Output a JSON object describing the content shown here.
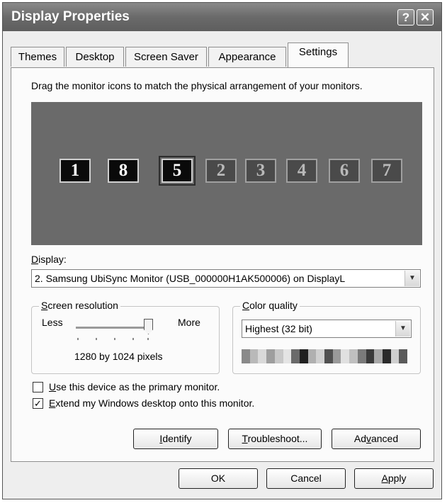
{
  "window": {
    "title": "Display Properties",
    "help_label": "?",
    "close_label": "✕"
  },
  "tabs": [
    {
      "label": "Themes"
    },
    {
      "label": "Desktop"
    },
    {
      "label": "Screen Saver"
    },
    {
      "label": "Appearance"
    },
    {
      "label": "Settings",
      "active": true
    }
  ],
  "settings": {
    "instruction": "Drag the monitor icons to match the physical arrangement of your monitors.",
    "monitors": [
      {
        "number": "1",
        "state": "active"
      },
      {
        "number": "8",
        "state": "active"
      },
      {
        "number": "5",
        "state": "active-selected"
      },
      {
        "number": "2",
        "state": "inactive"
      },
      {
        "number": "3",
        "state": "inactive"
      },
      {
        "number": "4",
        "state": "inactive"
      },
      {
        "number": "6",
        "state": "inactive"
      },
      {
        "number": "7",
        "state": "inactive"
      }
    ],
    "display": {
      "label_hotkey": "D",
      "label_rest": "isplay:",
      "value": "2. Samsung UbiSync Monitor (USB_000000H1AK500006) on DisplayL"
    },
    "screen_resolution": {
      "title_hotkey": "S",
      "title_rest": "creen resolution",
      "less_label": "Less",
      "more_label": "More",
      "value_text": "1280 by 1024 pixels",
      "slider_level": 1.0
    },
    "color_quality": {
      "title_hotkey": "C",
      "title_rest": "olor quality",
      "value": "Highest (32 bit)"
    },
    "primary_checkbox": {
      "hotkey": "U",
      "rest": "se this device as the primary monitor.",
      "checked": false
    },
    "extend_checkbox": {
      "hotkey": "E",
      "rest": "xtend my Windows desktop onto this monitor.",
      "checked": true,
      "check_glyph": "✓"
    },
    "identify_button": {
      "hotkey": "I",
      "rest": "dentify"
    },
    "troubleshoot_button": {
      "hotkey": "T",
      "rest": "roubleshoot..."
    },
    "advanced_button": {
      "before": "Ad",
      "hotkey": "v",
      "rest": "anced"
    }
  },
  "footer": {
    "ok_label": "OK",
    "cancel_label": "Cancel",
    "apply_hotkey": "A",
    "apply_rest": "pply"
  },
  "colors": {
    "monitor_area": "#6a6a6a",
    "active_monitor": "#0a0a0a",
    "inactive_monitor": "#4a4a4a"
  }
}
